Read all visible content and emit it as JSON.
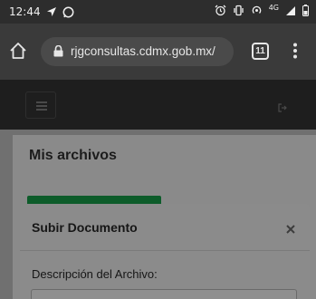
{
  "status_bar": {
    "time": "12:44",
    "network_label": "4G",
    "icons": [
      "navigation-arrow-icon",
      "whatsapp-icon",
      "alarm-icon",
      "vibrate-icon",
      "hotspot-icon",
      "signal-icon",
      "battery-icon"
    ]
  },
  "browser": {
    "url": "rjgconsultas.cdmx.gob.mx/",
    "tab_count": "11",
    "icons": [
      "home-icon",
      "lock-icon",
      "more-vert-icon"
    ]
  },
  "site_header": {
    "icons": [
      "hamburger-icon",
      "logout-icon"
    ]
  },
  "page": {
    "title": "Mis archivos"
  },
  "modal": {
    "title": "Subir Documento",
    "close_icon": "close-icon",
    "description_label": "Descripción del Archivo:",
    "description_value": ""
  },
  "colors": {
    "accent_green": "#0d5c2a",
    "status_bar_bg": "#2d2d2d",
    "browser_bar_bg": "#3a3a3a"
  }
}
